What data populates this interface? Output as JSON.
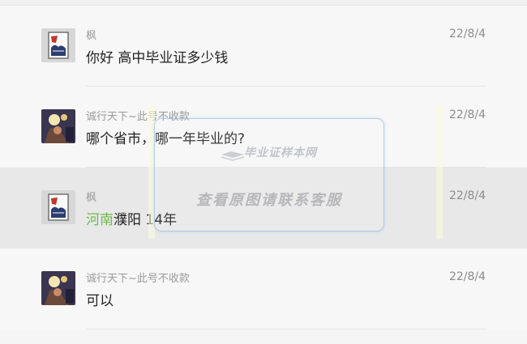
{
  "messages": [
    {
      "name": "枫",
      "time": "22/8/4",
      "text": "你好 高中毕业证多少钱",
      "avatar": "poster-avatar-icon"
    },
    {
      "name": "诚行天下~此号不收款",
      "time": "22/8/4",
      "text": "哪个省市，哪一年毕业的?",
      "avatar": "night-photo-avatar-icon"
    },
    {
      "name": "枫",
      "time": "22/8/4",
      "text_place": "河南",
      "text_rest": "濮阳 14年",
      "avatar": "poster-avatar-icon",
      "highlighted": true
    },
    {
      "name": "诚行天下~此号不收款",
      "time": "22/8/4",
      "text": "可以",
      "avatar": "night-photo-avatar-icon"
    }
  ],
  "watermark": {
    "brand": "毕业证样本网",
    "text": "查看原图请联系客服"
  },
  "colors": {
    "place_highlight": "#6cbb4a",
    "row_highlight": "#e8e8e8"
  }
}
